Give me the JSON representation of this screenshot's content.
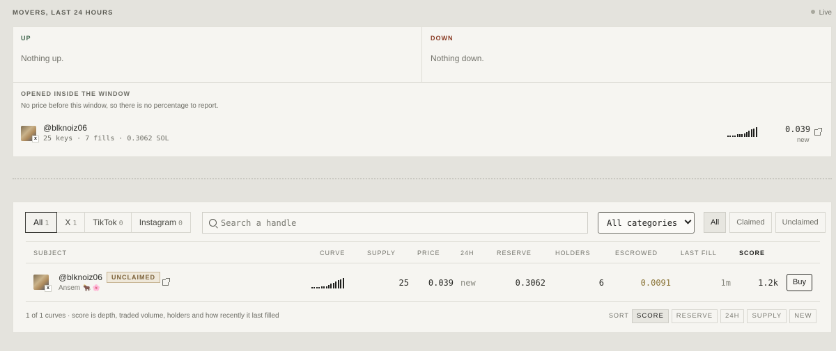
{
  "movers": {
    "title": "MOVERS, LAST 24 HOURS",
    "live_label": "Live",
    "up": {
      "label": "UP",
      "empty": "Nothing up."
    },
    "down": {
      "label": "DOWN",
      "empty": "Nothing down."
    },
    "opened": {
      "title": "OPENED INSIDE THE WINDOW",
      "note": "No price before this window, so there is no percentage to report.",
      "items": [
        {
          "avatar_icon": "user-avatar",
          "platform_badge": "x",
          "handle": "@blknoiz06",
          "meta": "25 keys · 7 fills · 0.3062 SOL",
          "sparkline": [
            1,
            1,
            1,
            1,
            2,
            2,
            2,
            3,
            4,
            5,
            6,
            7,
            8
          ],
          "price": "0.039",
          "change": "new"
        }
      ]
    }
  },
  "list": {
    "tabs": [
      {
        "label": "All",
        "count": "1",
        "active": true
      },
      {
        "label": "X",
        "count": "1",
        "active": false
      },
      {
        "label": "TikTok",
        "count": "0",
        "active": false
      },
      {
        "label": "Instagram",
        "count": "0",
        "active": false
      }
    ],
    "search": {
      "placeholder": "Search a handle",
      "value": ""
    },
    "category_select": {
      "selected": "All categories"
    },
    "claim_filters": [
      {
        "label": "All",
        "active": true
      },
      {
        "label": "Claimed",
        "active": false
      },
      {
        "label": "Unclaimed",
        "active": false
      }
    ],
    "columns": {
      "subject": "SUBJECT",
      "curve": "CURVE",
      "supply": "SUPPLY",
      "price": "PRICE",
      "change_24h": "24H",
      "reserve": "RESERVE",
      "holders": "HOLDERS",
      "escrowed": "ESCROWED",
      "last_fill": "LAST FILL",
      "score": "SCORE"
    },
    "rows": [
      {
        "avatar_icon": "user-avatar",
        "platform_badge": "x",
        "handle": "@blknoiz06",
        "status_badge": "UNCLAIMED",
        "name": "Ansem",
        "emoji_icons": "🐂 🌸",
        "sparkline": [
          1,
          1,
          1,
          1,
          2,
          2,
          2,
          3,
          4,
          5,
          6,
          7,
          8,
          9
        ],
        "supply": "25",
        "price": "0.039",
        "change_24h": "new",
        "reserve": "0.3062",
        "holders": "6",
        "escrowed": "0.0091",
        "last_fill": "1m",
        "score": "1.2k",
        "action_label": "Buy"
      }
    ],
    "footer": {
      "note": "1 of 1 curves · score is depth, traded volume, holders and how recently it last filled",
      "sort_label": "SORT",
      "sort_options": [
        {
          "label": "SCORE",
          "active": true
        },
        {
          "label": "RESERVE",
          "active": false
        },
        {
          "label": "24H",
          "active": false
        },
        {
          "label": "SUPPLY",
          "active": false
        },
        {
          "label": "NEW",
          "active": false
        }
      ]
    }
  }
}
